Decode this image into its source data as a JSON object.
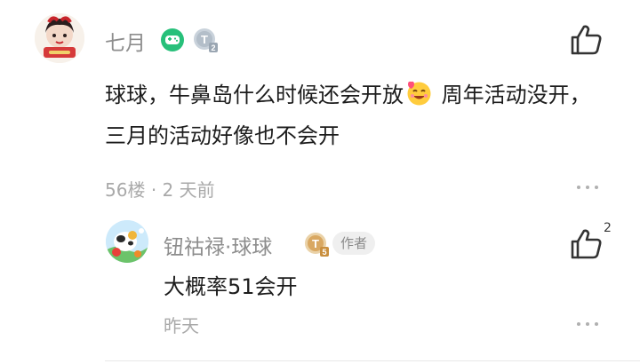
{
  "comment": {
    "author": "七月",
    "body_part1": "球球，牛鼻岛什么时候还会开放",
    "body_part2": " 周年活动没开，三月的活动好像也不会开",
    "floor": "56楼",
    "separator": "·",
    "time": "2 天前",
    "like_icon": "thumbs-up-icon",
    "more_icon": "more-dots-icon",
    "badges": [
      "gamepad-badge-icon",
      "level-t2-badge-icon"
    ]
  },
  "reply": {
    "author": "钮祜禄·球球",
    "author_tag": "作者",
    "body": "大概率51会开",
    "time": "昨天",
    "like_count": "2",
    "like_icon": "thumbs-up-icon",
    "more_icon": "more-dots-icon",
    "badges": [
      "level-t5-badge-icon"
    ]
  },
  "colors": {
    "name": "#8d8d8d",
    "meta": "#a9a9a9",
    "badge_green": "#27c07a",
    "badge_gold": "#d9a862"
  }
}
